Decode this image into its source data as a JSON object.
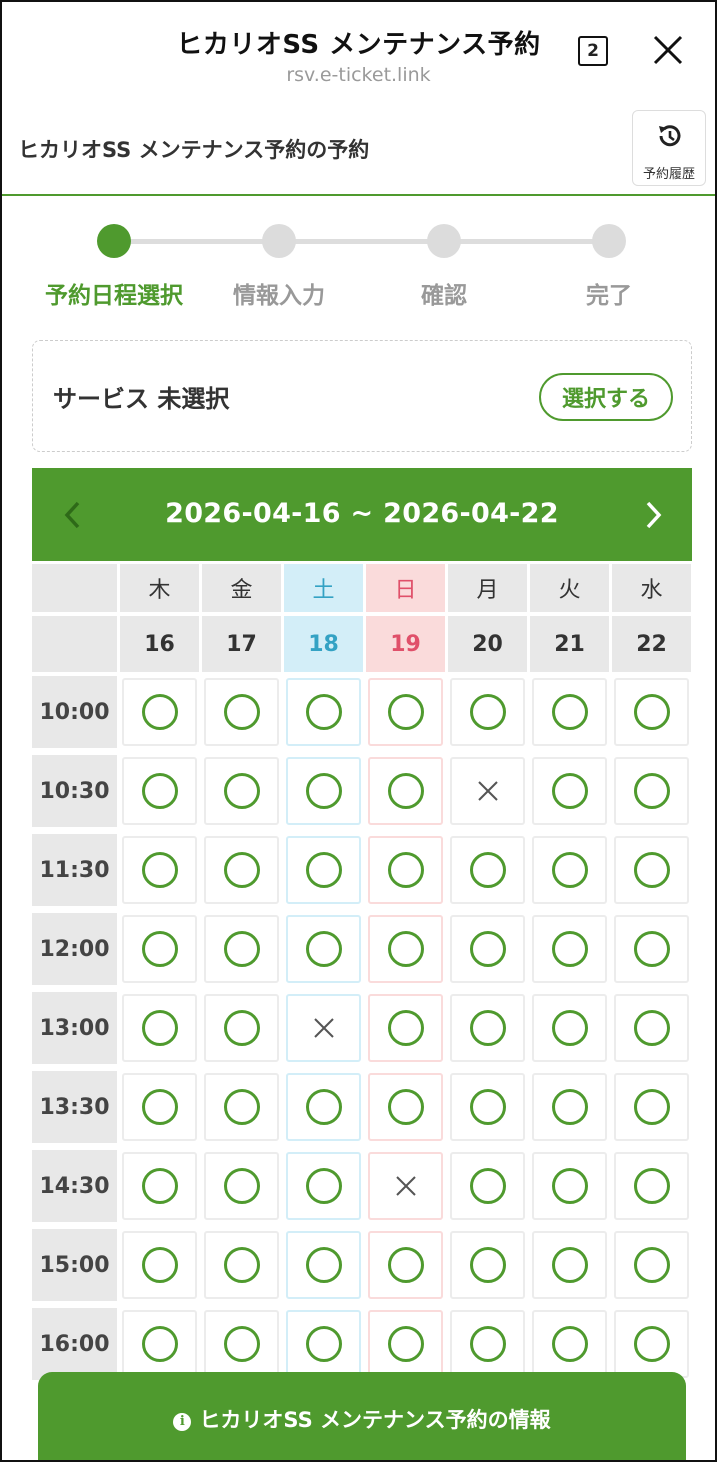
{
  "browser": {
    "title": "ヒカリオSS メンテナンス予約",
    "url": "rsv.e-ticket.link",
    "tab_count": "2"
  },
  "site": {
    "title": "ヒカリオSS メンテナンス予約の予約",
    "history_label": "予約履歴"
  },
  "steps": [
    {
      "label": "予約日程選択",
      "active": true
    },
    {
      "label": "情報入力",
      "active": false
    },
    {
      "label": "確認",
      "active": false
    },
    {
      "label": "完了",
      "active": false
    }
  ],
  "service": {
    "label": "サービス 未選択",
    "select_label": "選択する"
  },
  "calendar": {
    "range": "2026-04-16 ~ 2026-04-22",
    "days": [
      {
        "weekday": "木",
        "date": "16",
        "kind": "weekday"
      },
      {
        "weekday": "金",
        "date": "17",
        "kind": "weekday"
      },
      {
        "weekday": "土",
        "date": "18",
        "kind": "sat"
      },
      {
        "weekday": "日",
        "date": "19",
        "kind": "sun"
      },
      {
        "weekday": "月",
        "date": "20",
        "kind": "weekday"
      },
      {
        "weekday": "火",
        "date": "21",
        "kind": "weekday"
      },
      {
        "weekday": "水",
        "date": "22",
        "kind": "weekday"
      }
    ],
    "times": [
      "10:00",
      "10:30",
      "11:30",
      "12:00",
      "13:00",
      "13:30",
      "14:30",
      "15:00",
      "16:00"
    ],
    "availability": [
      [
        "o",
        "o",
        "o",
        "o",
        "o",
        "o",
        "o"
      ],
      [
        "o",
        "o",
        "o",
        "o",
        "x",
        "o",
        "o"
      ],
      [
        "o",
        "o",
        "o",
        "o",
        "o",
        "o",
        "o"
      ],
      [
        "o",
        "o",
        "o",
        "o",
        "o",
        "o",
        "o"
      ],
      [
        "o",
        "o",
        "x",
        "o",
        "o",
        "o",
        "o"
      ],
      [
        "o",
        "o",
        "o",
        "o",
        "o",
        "o",
        "o"
      ],
      [
        "o",
        "o",
        "o",
        "x",
        "o",
        "o",
        "o"
      ],
      [
        "o",
        "o",
        "o",
        "o",
        "o",
        "o",
        "o"
      ],
      [
        "o",
        "o",
        "o",
        "o",
        "o",
        "o",
        "o"
      ]
    ]
  },
  "info_bar": {
    "label": "ヒカリオSS メンテナンス予約の情報"
  },
  "colors": {
    "accent": "#4f9a2e",
    "saturday": "#34a2c4",
    "sunday": "#e0506a"
  }
}
